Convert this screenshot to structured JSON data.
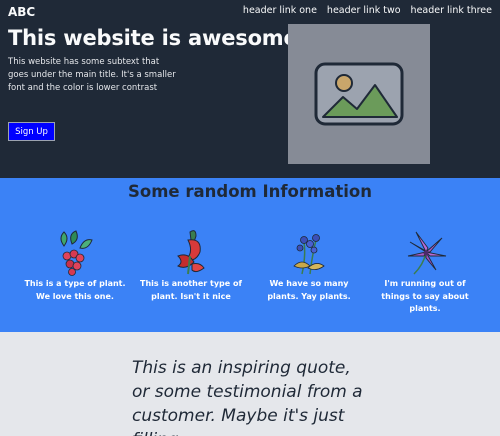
{
  "header": {
    "logo": "ABC",
    "links": [
      "header link one",
      "header link two",
      "header link three"
    ]
  },
  "hero": {
    "title": "This website is awesome",
    "subtitle": "This website has some subtext that goes under the main title. It's a smaller font and the color is lower contrast",
    "cta_label": "Sign Up",
    "image_icon": "image-placeholder-icon"
  },
  "info": {
    "title": "Some random Information",
    "items": [
      {
        "icon": "plant-icon",
        "caption": "This is a type of plant. We love this one."
      },
      {
        "icon": "red-flower-icon",
        "caption": "This is another type of plant. Isn't it nice"
      },
      {
        "icon": "blue-flower-icon",
        "caption": "We have so many plants. Yay plants."
      },
      {
        "icon": "purple-flower-icon",
        "caption": "I'm running out of things to say about plants."
      }
    ]
  },
  "quote": {
    "text": "This is an inspiring quote, or some testimonial from a customer. Maybe it's just filling"
  },
  "colors": {
    "hero_bg": "#1f2937",
    "info_bg": "#3b82f6",
    "quote_bg": "#e5e7eb",
    "cta_bg": "#0000ff"
  }
}
